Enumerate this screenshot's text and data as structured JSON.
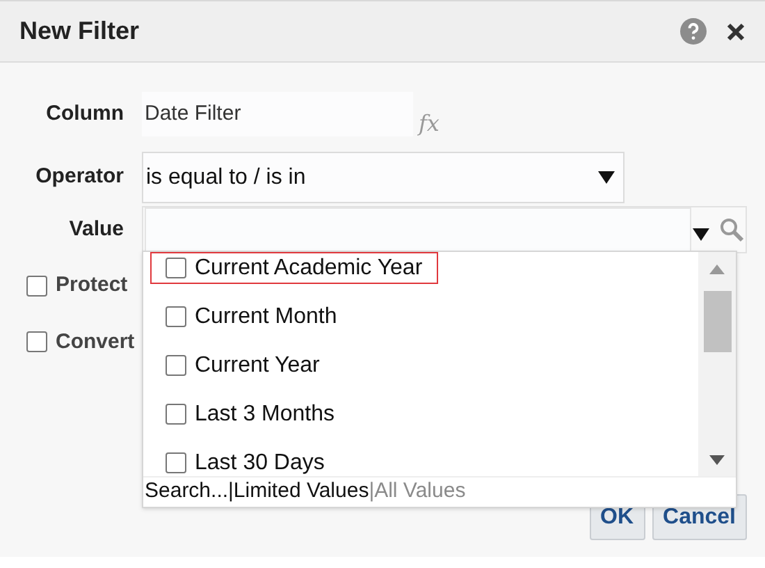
{
  "dialog": {
    "title": "New Filter"
  },
  "form": {
    "column": {
      "label": "Column",
      "value": "Date Filter",
      "formula_icon": "fx"
    },
    "operator": {
      "label": "Operator",
      "value": "is equal to / is in"
    },
    "value": {
      "label": "Value"
    },
    "options": [
      {
        "label": "Protect",
        "checked": false
      },
      {
        "label": "Convert",
        "checked": false
      }
    ]
  },
  "dropdown": {
    "items": [
      {
        "label": "Current Academic Year",
        "checked": false,
        "focused": true
      },
      {
        "label": "Current Month",
        "checked": false,
        "focused": false
      },
      {
        "label": "Current Year",
        "checked": false,
        "focused": false
      },
      {
        "label": "Last 3 Months",
        "checked": false,
        "focused": false
      },
      {
        "label": "Last 30 Days",
        "checked": false,
        "focused": false
      }
    ],
    "footer": [
      {
        "label": "Search...",
        "selected": false
      },
      {
        "label": "|Limited Values",
        "selected": false
      },
      {
        "label": "|All Values",
        "selected": true
      }
    ]
  },
  "buttons": [
    "OK",
    "Cancel"
  ]
}
